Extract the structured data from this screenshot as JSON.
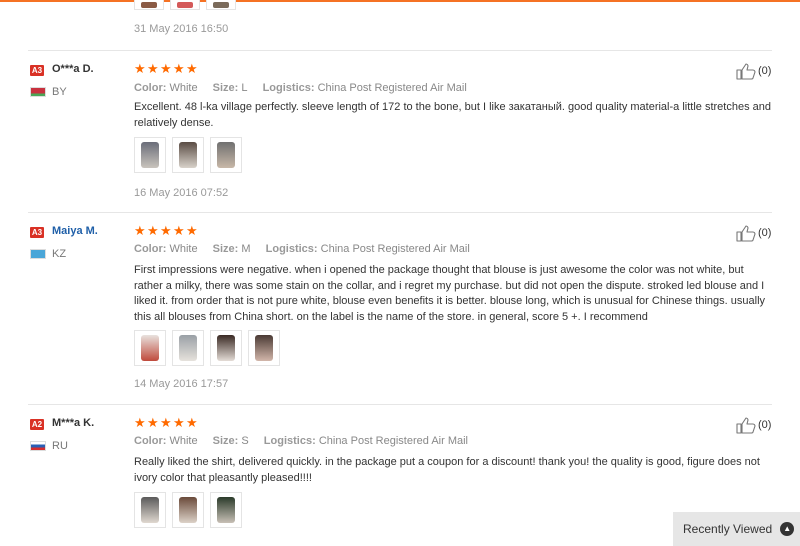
{
  "previous_review": {
    "date": "31 May 2016 16:50"
  },
  "reviews": [
    {
      "level": "A3",
      "username": "O***a D.",
      "country": "BY",
      "rating": 5,
      "color_label": "Color:",
      "color_value": "White",
      "size_label": "Size:",
      "size_value": "L",
      "logistics_label": "Logistics:",
      "logistics_value": "China Post Registered Air Mail",
      "text": "Excellent. 48 l-ka village perfectly. sleeve length of 172 to the bone, but I like закатаный. good quality material-a little stretches and relatively dense.",
      "photo_count": 3,
      "date": "16 May 2016 07:52",
      "likes": "(0)"
    },
    {
      "level": "A3",
      "username": "Maiya M.",
      "country": "KZ",
      "rating": 5,
      "color_label": "Color:",
      "color_value": "White",
      "size_label": "Size:",
      "size_value": "M",
      "logistics_label": "Logistics:",
      "logistics_value": "China Post Registered Air Mail",
      "text": "First impressions were negative. when i opened the package thought that blouse is just awesome the color was not white, but rather a milky, there was some stain on the collar, and i regret my purchase. but did not open the dispute. stroked led blouse and I liked it. from order that is not pure white, blouse even benefits it is better. blouse long, which is unusual for Chinese things. usually this all blouses from China short. on the label is the name of the store. in general, score 5 +. I recommend",
      "photo_count": 4,
      "date": "14 May 2016 17:57",
      "likes": "(0)"
    },
    {
      "level": "A2",
      "username": "M***a K.",
      "country": "RU",
      "rating": 5,
      "color_label": "Color:",
      "color_value": "White",
      "size_label": "Size:",
      "size_value": "S",
      "logistics_label": "Logistics:",
      "logistics_value": "China Post Registered Air Mail",
      "text": "Really liked the shirt, delivered quickly. in the package put a coupon for a discount! thank you! the quality is good, figure does not ivory color that pleasantly pleased!!!!",
      "photo_count": 3,
      "date": "",
      "likes": "(0)"
    }
  ],
  "recently_viewed": {
    "label": "Recently Viewed",
    "icon": "chevron-up-icon"
  },
  "colors": {
    "star": "#ff6a00",
    "badge": "#d93125",
    "accent": "#f57224"
  }
}
